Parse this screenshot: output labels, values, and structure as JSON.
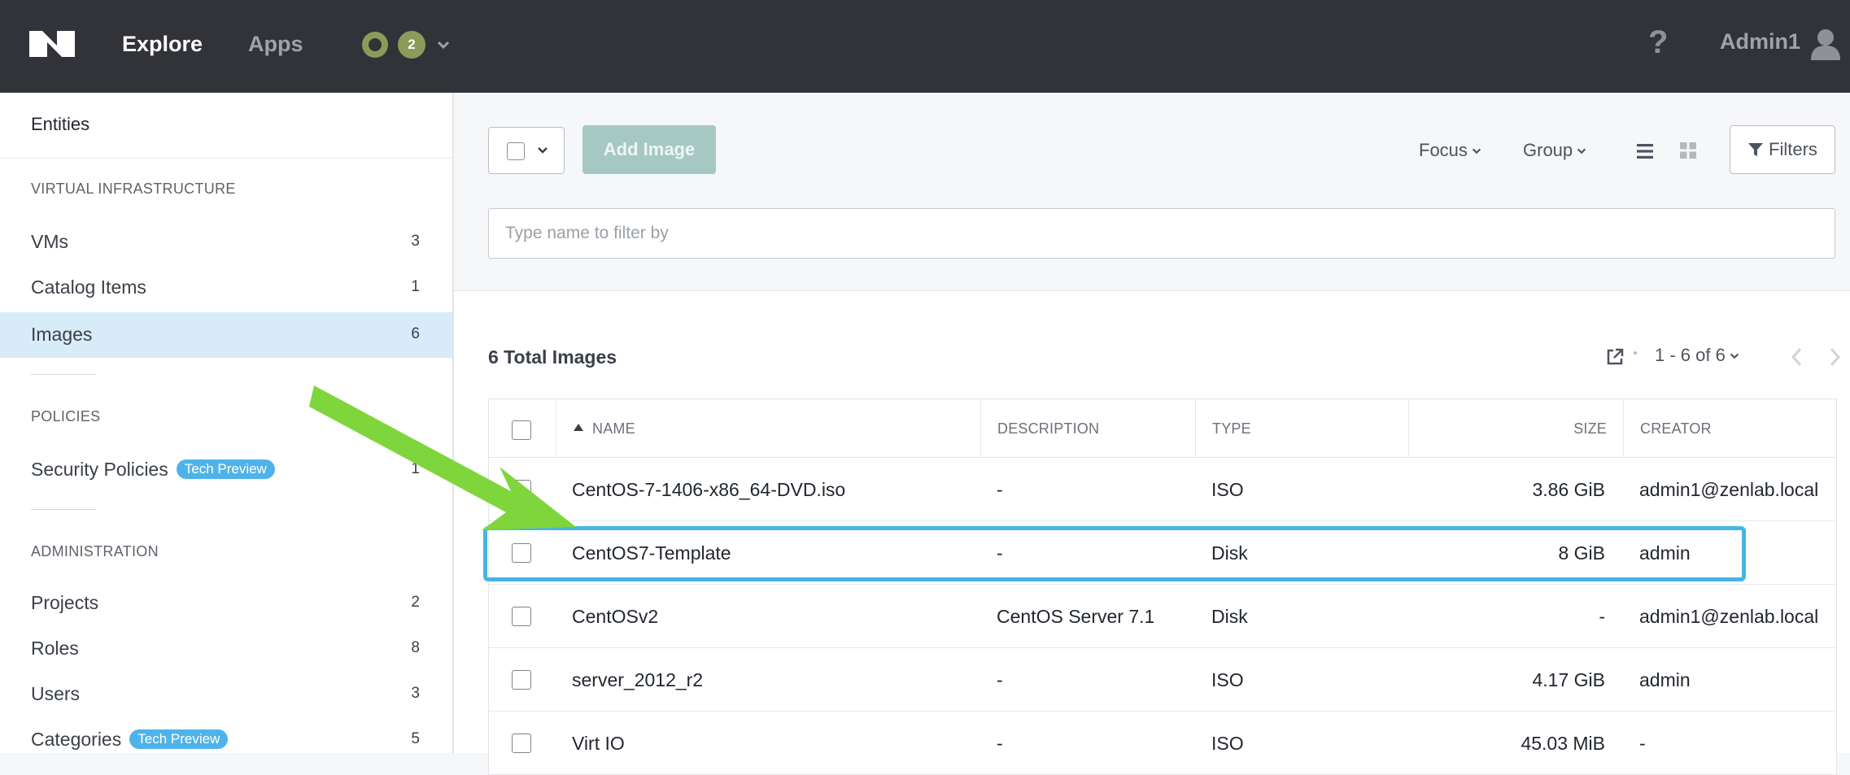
{
  "header": {
    "nav": [
      "Explore",
      "Apps"
    ],
    "status_count": "2",
    "user": "Admin1",
    "help_glyph": "?"
  },
  "sidebar": {
    "title": "Entities",
    "sections": [
      {
        "label": "VIRTUAL INFRASTRUCTURE",
        "items": [
          {
            "label": "VMs",
            "count": "3"
          },
          {
            "label": "Catalog Items",
            "count": "1"
          },
          {
            "label": "Images",
            "count": "6",
            "active": true
          }
        ]
      },
      {
        "label": "POLICIES",
        "items": [
          {
            "label": "Security Policies",
            "badge": "Tech Preview",
            "count": "1"
          }
        ]
      },
      {
        "label": "ADMINISTRATION",
        "items": [
          {
            "label": "Projects",
            "count": "2"
          },
          {
            "label": "Roles",
            "count": "8"
          },
          {
            "label": "Users",
            "count": "3"
          },
          {
            "label": "Categories",
            "badge": "Tech Preview",
            "count": "5"
          }
        ]
      }
    ]
  },
  "toolbar": {
    "add_label": "Add Image",
    "focus_label": "Focus",
    "group_label": "Group",
    "filters_label": "Filters",
    "search_placeholder": "Type name to filter by"
  },
  "summary": {
    "total": "6 Total Images",
    "pager": "1 - 6 of 6"
  },
  "table": {
    "columns": [
      "NAME",
      "DESCRIPTION",
      "TYPE",
      "SIZE",
      "CREATOR"
    ],
    "rows": [
      {
        "name": "CentOS-7-1406-x86_64-DVD.iso",
        "description": "-",
        "type": "ISO",
        "size": "3.86 GiB",
        "creator": "admin1@zenlab.local"
      },
      {
        "name": "CentOS7-Template",
        "description": "-",
        "type": "Disk",
        "size": "8 GiB",
        "creator": "admin"
      },
      {
        "name": "CentOSv2",
        "description": "CentOS Server 7.1",
        "type": "Disk",
        "size": "-",
        "creator": "admin1@zenlab.local"
      },
      {
        "name": "server_2012_r2",
        "description": "-",
        "type": "ISO",
        "size": "4.17 GiB",
        "creator": "admin"
      },
      {
        "name": "Virt IO",
        "description": "-",
        "type": "ISO",
        "size": "45.03 MiB",
        "creator": "-"
      }
    ]
  },
  "colors": {
    "topbar": "#323338",
    "accent_active": "#d8ebf8",
    "badge": "#4fb3ea",
    "highlight": "#45b4e6",
    "arrow": "#7ed63c",
    "add_button": "#a6c8c3"
  }
}
